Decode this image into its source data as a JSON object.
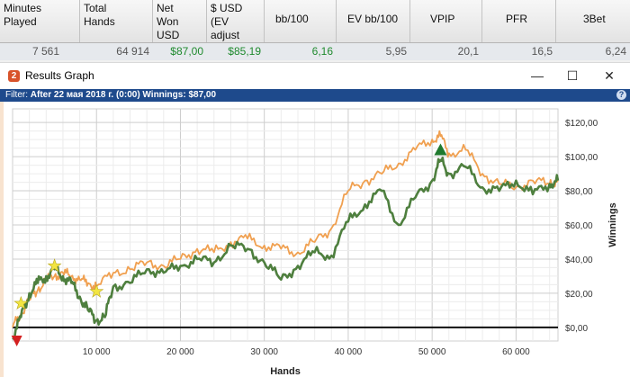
{
  "stats": {
    "headers": [
      "Minutes\nPlayed",
      "Total\nHands",
      "Net\nWon\nUSD",
      "$ USD\n(EV\nadjust",
      "bb/100",
      "EV bb/100",
      "VPIP",
      "PFR",
      "3Bet"
    ],
    "values": [
      "7 561",
      "64 914",
      "$87,00",
      "$85,19",
      "6,16",
      "5,95",
      "20,1",
      "16,5",
      "6,24"
    ]
  },
  "window": {
    "title": "Results Graph",
    "icon_letter": "2",
    "minimize": "—",
    "maximize": "☐",
    "close": "✕"
  },
  "filter": {
    "label": "Filter:",
    "text": "After 22 мая 2018 г. (0:00)  Winnings: $87,00",
    "help": "?"
  },
  "chart_data": {
    "type": "line",
    "xlabel": "Hands",
    "ylabel": "Winnings",
    "xlim": [
      0,
      65000
    ],
    "ylim": [
      -8,
      128
    ],
    "x_ticks": [
      10000,
      20000,
      30000,
      40000,
      50000,
      60000
    ],
    "x_tick_labels": [
      "10 000",
      "20 000",
      "30 000",
      "40 000",
      "50 000",
      "60 000"
    ],
    "y_ticks": [
      0,
      20,
      40,
      60,
      80,
      100,
      120
    ],
    "y_tick_labels": [
      "$0,00",
      "$20,00",
      "$40,00",
      "$60,00",
      "$80,00",
      "$100,00",
      "$120,00"
    ],
    "grid": true,
    "series": [
      {
        "color": "#f0a050",
        "x": [
          0,
          1000,
          2000,
          3000,
          4000,
          5000,
          6000,
          7000,
          8000,
          9000,
          10000,
          12000,
          14000,
          16000,
          18000,
          20000,
          22000,
          24000,
          26000,
          28000,
          30000,
          32000,
          34000,
          36000,
          38000,
          40000,
          42000,
          44000,
          46000,
          48000,
          50000,
          51000,
          52000,
          54000,
          56000,
          58000,
          60000,
          62000,
          64000,
          65000
        ],
        "y": [
          0,
          8,
          16,
          22,
          28,
          30,
          32,
          30,
          28,
          26,
          24,
          32,
          34,
          38,
          36,
          40,
          46,
          44,
          50,
          52,
          48,
          46,
          44,
          50,
          58,
          80,
          86,
          90,
          96,
          104,
          110,
          112,
          102,
          104,
          90,
          84,
          82,
          86,
          84,
          86
        ]
      },
      {
        "color": "#4e7f3e",
        "x": [
          0,
          1000,
          2000,
          3000,
          4000,
          5000,
          6000,
          7000,
          8000,
          9000,
          10000,
          11000,
          12000,
          14000,
          16000,
          18000,
          20000,
          22000,
          24000,
          26000,
          28000,
          30000,
          32000,
          34000,
          36000,
          38000,
          40000,
          42000,
          44000,
          46000,
          48000,
          50000,
          51000,
          52000,
          54000,
          56000,
          58000,
          60000,
          62000,
          64000,
          65000
        ],
        "y": [
          -6,
          6,
          20,
          26,
          30,
          34,
          30,
          26,
          18,
          10,
          4,
          6,
          24,
          26,
          34,
          32,
          36,
          40,
          38,
          48,
          46,
          38,
          28,
          36,
          44,
          42,
          62,
          72,
          80,
          60,
          76,
          86,
          98,
          90,
          94,
          82,
          80,
          86,
          78,
          84,
          86
        ]
      }
    ],
    "markers": [
      {
        "type": "star",
        "x": 1000,
        "y": 14
      },
      {
        "type": "star",
        "x": 5000,
        "y": 36
      },
      {
        "type": "star",
        "x": 10000,
        "y": 21
      },
      {
        "type": "triangle-up",
        "x": 51000,
        "y": 104
      },
      {
        "type": "triangle-down",
        "x": 500,
        "y": -8
      }
    ],
    "marker_colors": {
      "star": "#f2e542",
      "triangle-up": "#1f7a2e",
      "triangle-down": "#d42020"
    }
  }
}
